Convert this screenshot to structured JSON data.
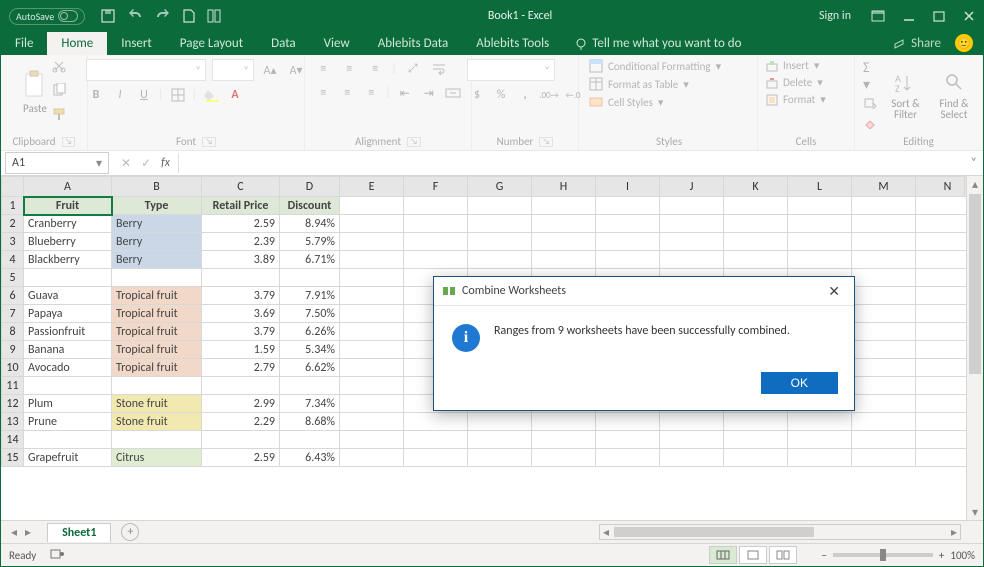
{
  "titlebar": {
    "autosave": "AutoSave",
    "title": "Book1 - Excel",
    "signin": "Sign in"
  },
  "tabs": {
    "file": "File",
    "home": "Home",
    "insert": "Insert",
    "pageLayout": "Page Layout",
    "data": "Data",
    "view": "View",
    "ablebitsData": "Ablebits Data",
    "ablebitsTools": "Ablebits Tools",
    "tell": "Tell me what you want to do",
    "share": "Share"
  },
  "ribbon": {
    "clipboard": {
      "paste": "Paste",
      "label": "Clipboard"
    },
    "font": {
      "label": "Font",
      "bold": "B",
      "italic": "I",
      "underline": "U"
    },
    "alignment": {
      "label": "Alignment"
    },
    "number": {
      "label": "Number",
      "dollar": "$",
      "percent": "%",
      "comma": ","
    },
    "styles": {
      "label": "Styles",
      "cond": "Conditional Formatting",
      "table": "Format as Table",
      "cell": "Cell Styles"
    },
    "cells": {
      "label": "Cells",
      "insert": "Insert",
      "delete": "Delete",
      "format": "Format"
    },
    "editing": {
      "label": "Editing",
      "sort": "Sort & Filter",
      "find": "Find & Select"
    }
  },
  "namebox": "A1",
  "columns": [
    "A",
    "B",
    "C",
    "D",
    "E",
    "F",
    "G",
    "H",
    "I",
    "J",
    "K",
    "L",
    "M",
    "N"
  ],
  "headers": {
    "fruit": "Fruit",
    "type": "Type",
    "price": "Retail Price",
    "discount": "Discount"
  },
  "rows": [
    {
      "r": 2,
      "fruit": "Cranberry",
      "type": "Berry",
      "price": "2.59",
      "disc": "8.94%",
      "cls": "berry"
    },
    {
      "r": 3,
      "fruit": "Blueberry",
      "type": "Berry",
      "price": "2.39",
      "disc": "5.79%",
      "cls": "berry"
    },
    {
      "r": 4,
      "fruit": "Blackberry",
      "type": "Berry",
      "price": "3.89",
      "disc": "6.71%",
      "cls": "berry"
    },
    {
      "r": 5
    },
    {
      "r": 6,
      "fruit": "Guava",
      "type": "Tropical fruit",
      "price": "3.79",
      "disc": "7.91%",
      "cls": "trop"
    },
    {
      "r": 7,
      "fruit": "Papaya",
      "type": "Tropical fruit",
      "price": "3.69",
      "disc": "7.50%",
      "cls": "trop"
    },
    {
      "r": 8,
      "fruit": "Passionfruit",
      "type": "Tropical fruit",
      "price": "3.79",
      "disc": "6.26%",
      "cls": "trop"
    },
    {
      "r": 9,
      "fruit": "Banana",
      "type": "Tropical fruit",
      "price": "1.59",
      "disc": "5.34%",
      "cls": "trop"
    },
    {
      "r": 10,
      "fruit": "Avocado",
      "type": "Tropical fruit",
      "price": "2.79",
      "disc": "6.62%",
      "cls": "trop"
    },
    {
      "r": 11
    },
    {
      "r": 12,
      "fruit": "Plum",
      "type": "Stone fruit",
      "price": "2.99",
      "disc": "7.34%",
      "cls": "stone"
    },
    {
      "r": 13,
      "fruit": "Prune",
      "type": "Stone fruit",
      "price": "2.29",
      "disc": "8.68%",
      "cls": "stone"
    },
    {
      "r": 14
    },
    {
      "r": 15,
      "fruit": "Grapefruit",
      "type": "Citrus",
      "price": "2.59",
      "disc": "6.43%",
      "cls": "citrus"
    }
  ],
  "sheetTab": "Sheet1",
  "status": {
    "ready": "Ready",
    "zoom": "100%"
  },
  "modal": {
    "title": "Combine Worksheets",
    "message": "Ranges from 9 worksheets have been successfully combined.",
    "ok": "OK"
  },
  "formulabar": {
    "expand": "˅"
  }
}
